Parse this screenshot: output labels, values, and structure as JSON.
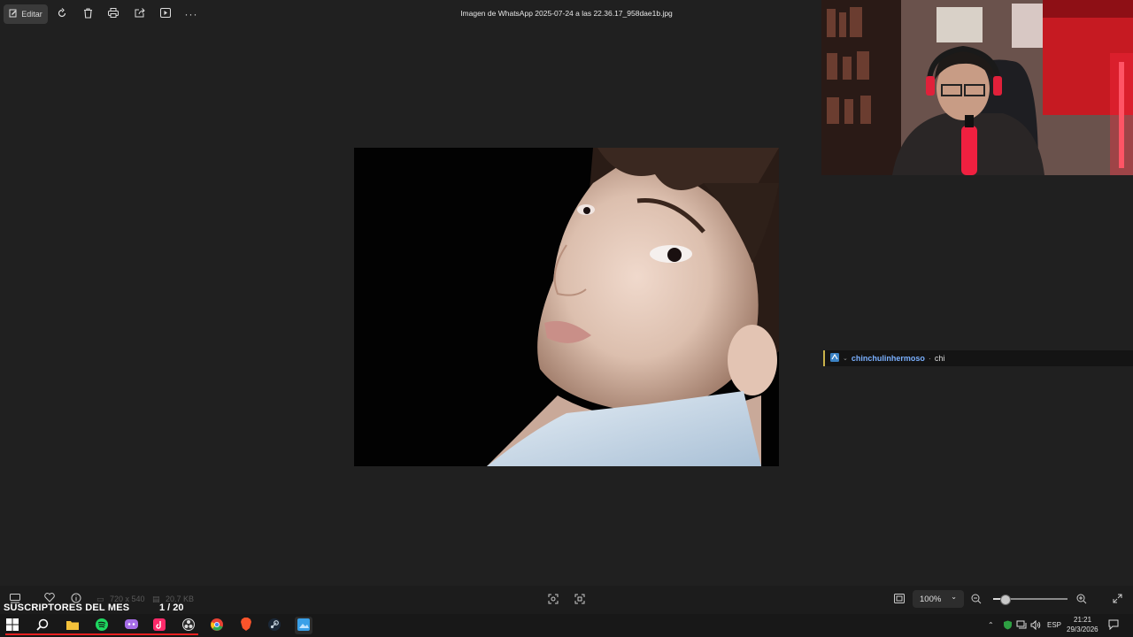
{
  "toolbar": {
    "edit_label": "Editar",
    "file_title": "Imagen de WhatsApp 2025-07-24 a las 22.36.17_958dae1b.jpg"
  },
  "chat": {
    "username": "chinchulinhermoso",
    "message": "chi"
  },
  "bottom_bar": {
    "dimensions": "720 x 540",
    "file_size": "20.7 KB",
    "zoom_level": "100%",
    "zoom_slider_fraction": 0.15
  },
  "overlay": {
    "subscribers_label": "SUSCRIPTORES DEL MES",
    "subscribers_count": "1 / 20"
  },
  "system_tray": {
    "language": "ESP",
    "time": "21:21",
    "date": "29/3/2026"
  },
  "taskbar_apps": [
    "start-icon",
    "search-icon",
    "file-explorer-icon",
    "spotify-icon",
    "discord-icon",
    "tiktok-icon",
    "obs-icon",
    "chrome-icon",
    "brave-icon",
    "steam-icon",
    "photos-icon"
  ],
  "colors": {
    "accent_red": "#e82020",
    "chat_username": "#7ab0ff",
    "chat_highlight": "#c9b24a"
  }
}
